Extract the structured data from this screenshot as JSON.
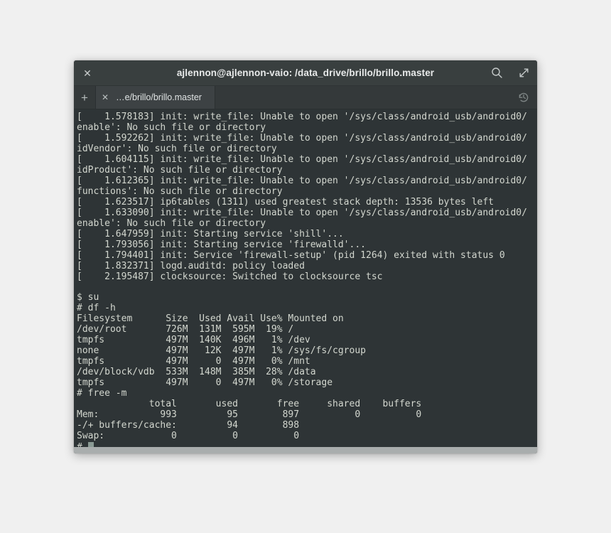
{
  "window": {
    "title": "ajlennon@ajlennon-vaio: /data_drive/brillo/brillo.master",
    "close_label": "✕",
    "search_icon": "search-icon",
    "expand_icon": "expand-icon"
  },
  "tabbar": {
    "new_tab_label": "+",
    "tab_close_label": "✕",
    "tab_label": "…e/brillo/brillo.master",
    "history_icon": "history-icon"
  },
  "colors": {
    "page_background": "#f0f0f0",
    "titlebar_background": "#393f3f",
    "tabbar_background": "#34393a",
    "active_tab_background": "#3d4244",
    "terminal_background": "#2e3436",
    "terminal_foreground": "#d3d7cf",
    "cursor": "#8a9a94"
  },
  "terminal": {
    "prompt_user": "$",
    "prompt_root": "#",
    "cursor_visible": true,
    "lines": [
      "[    1.578183] init: write_file: Unable to open '/sys/class/android_usb/android0/",
      "enable': No such file or directory",
      "[    1.592262] init: write_file: Unable to open '/sys/class/android_usb/android0/",
      "idVendor': No such file or directory",
      "[    1.604115] init: write_file: Unable to open '/sys/class/android_usb/android0/",
      "idProduct': No such file or directory",
      "[    1.612365] init: write_file: Unable to open '/sys/class/android_usb/android0/",
      "functions': No such file or directory",
      "[    1.623517] ip6tables (1311) used greatest stack depth: 13536 bytes left",
      "[    1.633090] init: write_file: Unable to open '/sys/class/android_usb/android0/",
      "enable': No such file or directory",
      "[    1.647959] init: Starting service 'shill'...",
      "[    1.793056] init: Starting service 'firewalld'...",
      "[    1.794401] init: Service 'firewall-setup' (pid 1264) exited with status 0",
      "[    1.832371] logd.auditd: policy loaded",
      "[    2.195487] clocksource: Switched to clocksource tsc",
      "",
      "$ su",
      "# df -h",
      "Filesystem      Size  Used Avail Use% Mounted on",
      "/dev/root       726M  131M  595M  19% /",
      "tmpfs           497M  140K  496M   1% /dev",
      "none            497M   12K  497M   1% /sys/fs/cgroup",
      "tmpfs           497M     0  497M   0% /mnt",
      "/dev/block/vdb  533M  148M  385M  28% /data",
      "tmpfs           497M     0  497M   0% /storage",
      "# free -m",
      "             total       used       free     shared    buffers",
      "Mem:           993         95        897          0          0",
      "-/+ buffers/cache:         94        898",
      "Swap:            0          0          0"
    ],
    "df_table": {
      "command": "df -h",
      "headers": [
        "Filesystem",
        "Size",
        "Used",
        "Avail",
        "Use%",
        "Mounted on"
      ],
      "rows": [
        [
          "/dev/root",
          "726M",
          "131M",
          "595M",
          "19%",
          "/"
        ],
        [
          "tmpfs",
          "497M",
          "140K",
          "496M",
          "1%",
          "/dev"
        ],
        [
          "none",
          "497M",
          "12K",
          "497M",
          "1%",
          "/sys/fs/cgroup"
        ],
        [
          "tmpfs",
          "497M",
          "0",
          "497M",
          "0%",
          "/mnt"
        ],
        [
          "/dev/block/vdb",
          "533M",
          "148M",
          "385M",
          "28%",
          "/data"
        ],
        [
          "tmpfs",
          "497M",
          "0",
          "497M",
          "0%",
          "/storage"
        ]
      ]
    },
    "free_table": {
      "command": "free -m",
      "headers": [
        "",
        "total",
        "used",
        "free",
        "shared",
        "buffers"
      ],
      "rows": [
        [
          "Mem:",
          "993",
          "95",
          "897",
          "0",
          "0"
        ],
        [
          "-/+ buffers/cache:",
          "",
          "94",
          "898",
          "",
          ""
        ],
        [
          "Swap:",
          "0",
          "0",
          "0",
          "",
          ""
        ]
      ]
    }
  }
}
